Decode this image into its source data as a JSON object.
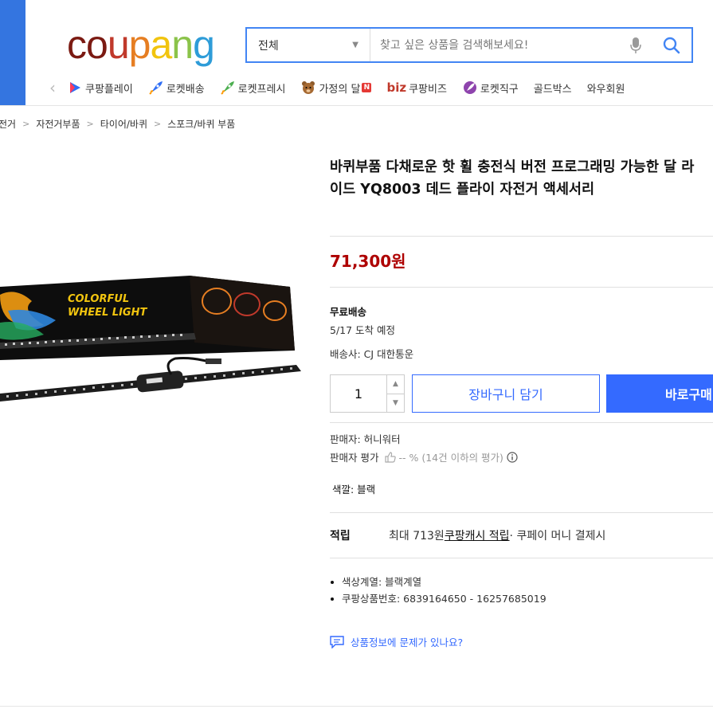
{
  "header": {
    "logo": [
      "c",
      "o",
      "u",
      "p",
      "a",
      "n",
      "g"
    ],
    "search": {
      "category": "전체",
      "placeholder": "찾고 싶은 상품을 검색해보세요!"
    }
  },
  "nav": {
    "items": [
      {
        "label": "쿠팡플레이",
        "icon": "play-icon"
      },
      {
        "label": "로켓배송",
        "icon": "rocket-icon"
      },
      {
        "label": "로켓프레시",
        "icon": "rocket-fresh-icon"
      },
      {
        "label": "가정의 달",
        "icon": "bear-icon",
        "badge": "N"
      },
      {
        "label": "쿠팡비즈",
        "icon": "biz-icon",
        "prefix": "biz"
      },
      {
        "label": "로켓직구",
        "icon": "globe-rocket-icon"
      },
      {
        "label": "골드박스",
        "icon": ""
      },
      {
        "label": "와우회원",
        "icon": ""
      }
    ]
  },
  "breadcrumb": [
    "전거",
    "자전거부품",
    "타이어/바퀴",
    "스포크/바퀴 부품"
  ],
  "product": {
    "image_text": "COLORFUL WHEEL LIGHT",
    "title": "바퀴부품 다채로운 핫 휠 충전식 버전 프로그래밍 가능한 달 라이드 YQ8003 데드 플라이 자전거 액세서리",
    "price": "71,300원",
    "shipping": {
      "free": "무료배송",
      "arrival": "5/17 도착 예정",
      "carrier": "배송사: CJ 대한통운"
    },
    "quantity": "1",
    "cart_button": "장바구니 담기",
    "buy_button": "바로구매",
    "seller": "판매자: 허니워터",
    "seller_rating_label": "판매자 평가",
    "seller_rating_value": "-- % (14건 이하의 평가)",
    "color_option": "색깔: 블랙",
    "reward": {
      "label": "적립",
      "prefix": "최대 713원 ",
      "link": "쿠팡캐시 적립",
      "suffix": " · 쿠페이 머니 결제시"
    },
    "bullets": [
      "색상계열: 블랙계열",
      "쿠팡상품번호: 6839164650 - 16257685019"
    ],
    "report_link": "상품정보에 문제가 있나요?"
  },
  "colors": {
    "brand_blue": "#346aff",
    "price_red": "#ae0000",
    "logo": [
      "#7b1a12",
      "#7b1a12",
      "#c0392b",
      "#e67e22",
      "#f1c40f",
      "#8bc34a",
      "#2e9cd8"
    ]
  }
}
